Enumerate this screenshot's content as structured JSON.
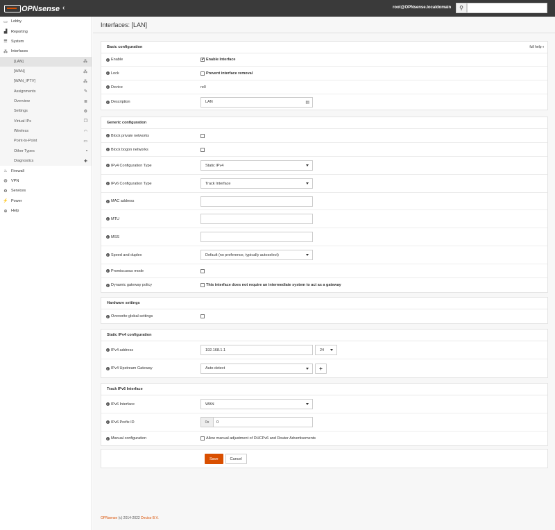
{
  "topbar": {
    "logo_brand": "OPN",
    "logo_sense": "sense",
    "user": "root@OPNsense.localdomain",
    "toggle_icon": "chevron-left-icon"
  },
  "sidebar": {
    "top_items": [
      {
        "label": "Lobby",
        "icon": "laptop-icon"
      },
      {
        "label": "Reporting",
        "icon": "chart-icon"
      },
      {
        "label": "System",
        "icon": "server-icon"
      },
      {
        "label": "Interfaces",
        "icon": "sitemap-icon"
      }
    ],
    "sub_items": [
      {
        "label": "[LAN]",
        "icon": "sitemap-icon"
      },
      {
        "label": "[WAN]",
        "icon": "sitemap-icon"
      },
      {
        "label": "[WAN_IPTV]",
        "icon": "sitemap-icon"
      },
      {
        "label": "Assignments",
        "icon": "pencil-icon"
      },
      {
        "label": "Overview",
        "icon": "list-icon"
      },
      {
        "label": "Settings",
        "icon": "cogs-icon"
      },
      {
        "label": "Virtual IPs",
        "icon": "copy-icon"
      },
      {
        "label": "Wireless",
        "icon": "wifi-icon"
      },
      {
        "label": "Point-to-Point",
        "icon": "hdd-icon"
      },
      {
        "label": "Other Types",
        "icon": "archive-icon"
      },
      {
        "label": "Diagnostics",
        "icon": "medkit-icon"
      }
    ],
    "bottom_items": [
      {
        "label": "Firewall",
        "icon": "fire-icon"
      },
      {
        "label": "VPN",
        "icon": "globe-icon"
      },
      {
        "label": "Services",
        "icon": "cog-icon"
      },
      {
        "label": "Power",
        "icon": "plug-icon"
      },
      {
        "label": "Help",
        "icon": "support-icon"
      }
    ]
  },
  "page": {
    "title": "Interfaces: [LAN]",
    "full_help": "full help"
  },
  "basic": {
    "heading": "Basic configuration",
    "enable_label": "Enable",
    "enable_text": "Enable Interface",
    "lock_label": "Lock",
    "lock_text": "Prevent interface removal",
    "device_label": "Device",
    "device_value": "re0",
    "description_label": "Description",
    "description_value": "LAN"
  },
  "generic": {
    "heading": "Generic configuration",
    "block_private": "Block private networks",
    "block_bogon": "Block bogon networks",
    "ipv4_type_label": "IPv4 Configuration Type",
    "ipv4_type_value": "Static IPv4",
    "ipv6_type_label": "IPv6 Configuration Type",
    "ipv6_type_value": "Track Interface",
    "mac_label": "MAC address",
    "mtu_label": "MTU",
    "mss_label": "MSS",
    "speed_label": "Speed and duplex",
    "speed_value": "Default (no preference, typically autoselect)",
    "promisc_label": "Promiscuous mode",
    "dyn_gw_label": "Dynamic gateway policy",
    "dyn_gw_text": "This interface does not require an intermediate system to act as a gateway"
  },
  "hardware": {
    "heading": "Hardware settings",
    "overwrite_label": "Overwrite global settings"
  },
  "static4": {
    "heading": "Static IPv4 configuration",
    "addr_label": "IPv4 address",
    "addr_value": "192.168.1.1",
    "prefix_value": "24",
    "gw_label": "IPv4 Upstream Gateway",
    "gw_value": "Auto-detect",
    "add_symbol": "+"
  },
  "track6": {
    "heading": "Track IPv6 Interface",
    "iface_label": "IPv6 Interface",
    "iface_value": "WAN",
    "prefix_id_label": "IPv6 Prefix ID",
    "prefix_id_addon": "0x",
    "prefix_id_value": "0",
    "manual_label": "Manual configuration",
    "manual_text": "Allow manual adjustment of DHCPv6 and Router Advertisements"
  },
  "actions": {
    "save": "Save",
    "cancel": "Cancel"
  },
  "footer": {
    "brand": "OPNsense",
    "text": " (c) 2014-2022 ",
    "company": "Deciso B.V."
  },
  "colors": {
    "accent": "#d94f00",
    "topbar": "#3a3a3a"
  }
}
